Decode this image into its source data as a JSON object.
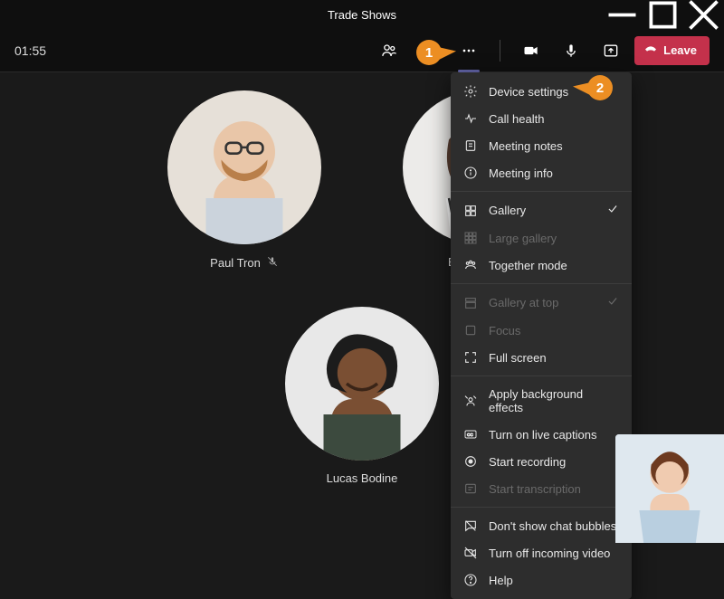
{
  "window": {
    "title": "Trade Shows"
  },
  "call": {
    "timer": "01:55",
    "leave_label": "Leave"
  },
  "participants": [
    {
      "name": "Paul Tron",
      "muted": true
    },
    {
      "name": "Erika Araujo",
      "muted": false
    },
    {
      "name": "Lucas Bodine",
      "muted": false
    }
  ],
  "menu": {
    "device_settings": "Device settings",
    "call_health": "Call health",
    "meeting_notes": "Meeting notes",
    "meeting_info": "Meeting info",
    "gallery": "Gallery",
    "large_gallery": "Large gallery",
    "together_mode": "Together mode",
    "gallery_at_top": "Gallery at top",
    "focus": "Focus",
    "full_screen": "Full screen",
    "apply_bg": "Apply background effects",
    "live_captions": "Turn on live captions",
    "start_recording": "Start recording",
    "start_transcription": "Start transcription",
    "dont_show_chat": "Don't show chat bubbles",
    "turn_off_incoming": "Turn off incoming video",
    "help": "Help"
  },
  "callouts": {
    "one": "1",
    "two": "2"
  }
}
